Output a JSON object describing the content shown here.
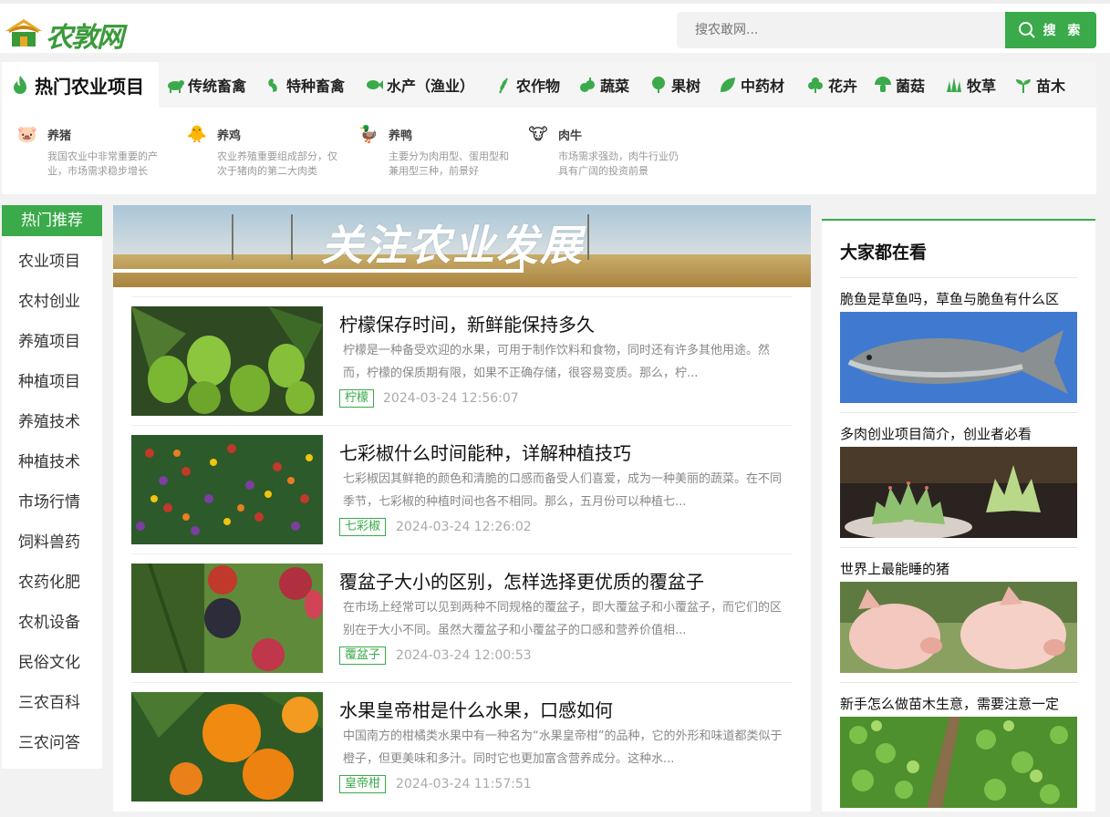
{
  "site": {
    "logo_text": "农敦网"
  },
  "search": {
    "placeholder": "搜农敢网...",
    "button_label": "搜 索"
  },
  "colors": {
    "accent": "#3aaa4a"
  },
  "categories": {
    "active_label": "热门农业项目",
    "items": [
      {
        "label": "传统畜禽",
        "icon": "cow-icon"
      },
      {
        "label": "特种畜禽",
        "icon": "bird-icon"
      },
      {
        "label": "水产（渔业）",
        "icon": "fish-icon"
      },
      {
        "label": "农作物",
        "icon": "wheat-icon"
      },
      {
        "label": "蔬菜",
        "icon": "vegetable-icon"
      },
      {
        "label": "果树",
        "icon": "fruit-tree-icon"
      },
      {
        "label": "中药材",
        "icon": "herb-leaf-icon"
      },
      {
        "label": "花卉",
        "icon": "flower-icon"
      },
      {
        "label": "菌菇",
        "icon": "mushroom-icon"
      },
      {
        "label": "牧草",
        "icon": "grass-icon"
      },
      {
        "label": "苗木",
        "icon": "sprout-icon"
      }
    ]
  },
  "subcategories": [
    {
      "name": "养猪",
      "desc": "我国农业中非常重要的产业，市场需求稳步增长",
      "icon": "pig-icon"
    },
    {
      "name": "养鸡",
      "desc": "农业养殖重要组成部分，仅次于猪肉的第二大肉类",
      "icon": "chick-icon"
    },
    {
      "name": "养鸭",
      "desc": "主要分为肉用型、蛋用型和兼用型三种，前景好",
      "icon": "duck-icon"
    },
    {
      "name": "肉牛",
      "desc": "市场需求强劲，肉牛行业仍具有广阔的投资前景",
      "icon": "cow-head-icon"
    }
  ],
  "leftnav": {
    "active": "热门推荐",
    "items": [
      "农业项目",
      "农村创业",
      "养殖项目",
      "种植项目",
      "养殖技术",
      "种植技术",
      "市场行情",
      "饲料兽药",
      "农药化肥",
      "农机设备",
      "民俗文化",
      "三农百科",
      "三农问答"
    ]
  },
  "banner": {
    "title": "关注农业发展"
  },
  "articles": [
    {
      "title": "柠檬保存时间，新鲜能保持多久",
      "excerpt": "柠檬是一种备受欢迎的水果，可用于制作饮料和食物，同时还有许多其他用途。然而，柠檬的保质期有限，如果不正确存储，很容易变质。那么，柠...",
      "tag": "柠檬",
      "date": "2024-03-24 12:56:07"
    },
    {
      "title": "七彩椒什么时间能种，详解种植技巧",
      "excerpt": "七彩椒因其鲜艳的颜色和清脆的口感而备受人们喜爱，成为一种美丽的蔬菜。在不同季节，七彩椒的种植时间也各不相同。那么，五月份可以种植七...",
      "tag": "七彩椒",
      "date": "2024-03-24 12:26:02"
    },
    {
      "title": "覆盆子大小的区别，怎样选择更优质的覆盆子",
      "excerpt": "在市场上经常可以见到两种不同规格的覆盆子，即大覆盆子和小覆盆子，而它们的区别在于大小不同。虽然大覆盆子和小覆盆子的口感和营养价值相...",
      "tag": "覆盆子",
      "date": "2024-03-24 12:00:53"
    },
    {
      "title": "水果皇帝柑是什么水果，口感如何",
      "excerpt": "中国南方的柑橘类水果中有一种名为“水果皇帝柑”的品种，它的外形和味道都类似于橙子，但更美味和多汁。同时它也更加富含营养成分。这种水...",
      "tag": "皇帝柑",
      "date": "2024-03-24 11:57:51"
    }
  ],
  "sidebar": {
    "title": "大家都在看",
    "items": [
      {
        "title": "脆鱼是草鱼吗，草鱼与脆鱼有什么区"
      },
      {
        "title": "多肉创业项目简介，创业者必看"
      },
      {
        "title": "世界上最能睡的猪"
      },
      {
        "title": "新手怎么做苗木生意，需要注意一定"
      }
    ]
  }
}
